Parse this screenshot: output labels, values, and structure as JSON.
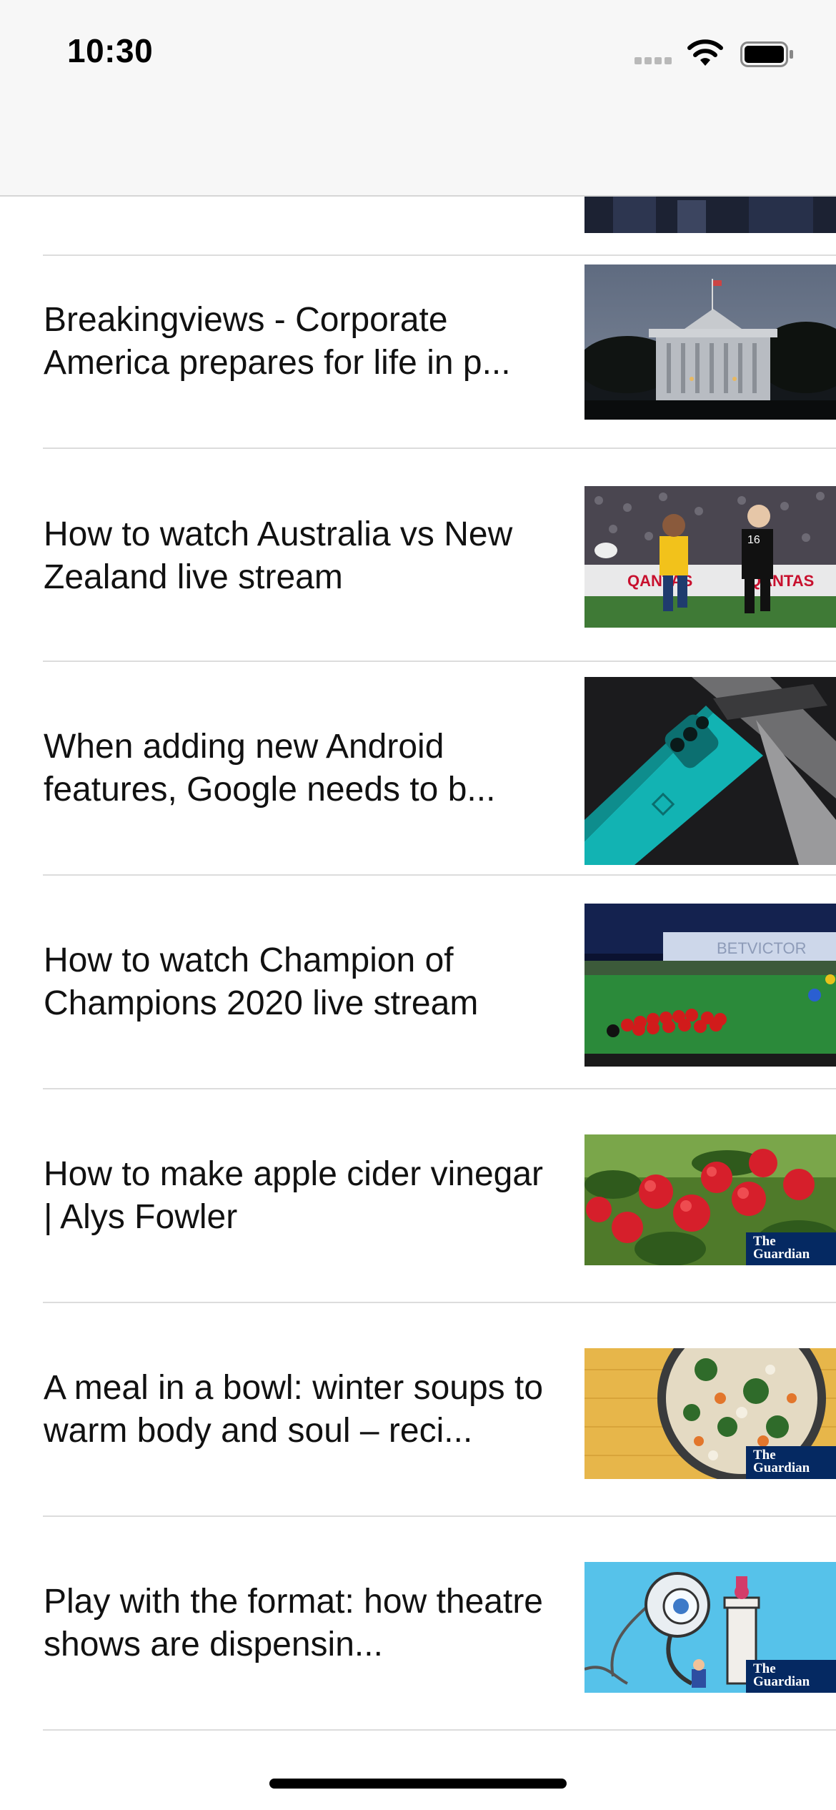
{
  "status_bar": {
    "time": "10:30"
  },
  "articles": [
    {
      "title": "Breakingviews - Corporate America prepares for life in p...",
      "thumbnail": "white-house-night"
    },
    {
      "title": "How to watch Australia vs New Zealand live stream",
      "thumbnail": "rugby-match"
    },
    {
      "title": "When adding new Android features, Google needs to b...",
      "thumbnail": "teal-android-phone"
    },
    {
      "title": "How to watch Champion of Champions 2020 live stream",
      "thumbnail": "snooker-table"
    },
    {
      "title": "How to make apple cider vinegar | Alys Fowler",
      "thumbnail": "apple-tree",
      "badge": "The Guardian"
    },
    {
      "title": "A meal in a bowl: winter soups to warm body and soul – reci...",
      "thumbnail": "soup-bowl",
      "badge": "The Guardian"
    },
    {
      "title": "Play with the format: how theatre shows are dispensin...",
      "thumbnail": "webcam-illustration",
      "badge": "The Guardian"
    }
  ],
  "colors": {
    "header_bg": "#f7f7f7",
    "divider": "#dcdcdc",
    "guardian_blue": "#052962"
  }
}
